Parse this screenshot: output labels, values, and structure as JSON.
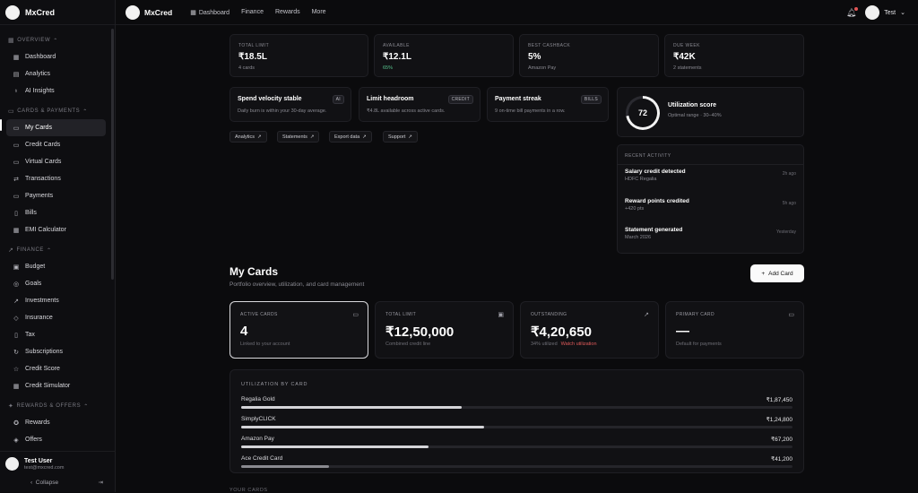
{
  "brand": {
    "name": "MxCred"
  },
  "topbar": {
    "nav": [
      {
        "label": "Dashboard",
        "icon": "grid-icon"
      },
      {
        "label": "Finance"
      },
      {
        "label": "Rewards"
      },
      {
        "label": "More"
      }
    ],
    "user": "Test"
  },
  "sidebar": {
    "sections": [
      {
        "title": "OVERVIEW",
        "items": [
          "Dashboard",
          "Analytics",
          "AI Insights"
        ]
      },
      {
        "title": "CARDS & PAYMENTS",
        "items": [
          "My Cards",
          "Credit Cards",
          "Virtual Cards",
          "Transactions",
          "Payments",
          "Bills",
          "EMI Calculator"
        ]
      },
      {
        "title": "FINANCE",
        "items": [
          "Budget",
          "Goals",
          "Investments",
          "Insurance",
          "Tax",
          "Subscriptions",
          "Credit Score",
          "Credit Simulator"
        ]
      },
      {
        "title": "REWARDS & OFFERS",
        "items": [
          "Rewards",
          "Offers"
        ]
      }
    ],
    "active_item": "My Cards",
    "user": {
      "name": "Test User",
      "email": "test@mxcred.com"
    },
    "collapse_label": "Collapse"
  },
  "stats": [
    {
      "label": "TOTAL LIMIT",
      "value": "₹18.5L",
      "sub": "4 cards"
    },
    {
      "label": "AVAILABLE",
      "value": "₹12.1L",
      "sub": "65%"
    },
    {
      "label": "BEST CASHBACK",
      "value": "5%",
      "sub": "Amazon Pay"
    },
    {
      "label": "DUE WEEK",
      "value": "₹42K",
      "sub": "2 statements"
    }
  ],
  "insights": [
    {
      "title": "Spend velocity stable",
      "badge": "AI",
      "desc": "Daily burn is within your 30-day average."
    },
    {
      "title": "Limit headroom",
      "badge": "CREDIT",
      "desc": "₹4.8L available across active cards."
    },
    {
      "title": "Payment streak",
      "badge": "BILLS",
      "desc": "9 on-time bill payments in a row."
    }
  ],
  "quick_links": [
    "Analytics",
    "Statements",
    "Export data",
    "Support"
  ],
  "utilization_score": {
    "value": 72,
    "title": "Utilization score",
    "sub": "Optimal range · 30–40%"
  },
  "recent_activity": {
    "title": "RECENT ACTIVITY",
    "items": [
      {
        "title": "Salary credit detected",
        "sub": "HDFC Regalia",
        "time": "2h ago"
      },
      {
        "title": "Reward points credited",
        "sub": "+420 pts",
        "time": "5h ago"
      },
      {
        "title": "Statement generated",
        "sub": "March 2026",
        "time": "Yesterday"
      }
    ]
  },
  "page": {
    "title": "My Cards",
    "subtitle": "Portfolio overview, utilization, and card management",
    "add_label": "Add Card"
  },
  "metrics": [
    {
      "label": "ACTIVE CARDS",
      "value": "4",
      "sub": "Linked to your account",
      "icon": "card-icon"
    },
    {
      "label": "TOTAL LIMIT",
      "value": "₹12,50,000",
      "sub": "Combined credit line",
      "icon": "wallet-icon"
    },
    {
      "label": "OUTSTANDING",
      "value": "₹4,20,650",
      "sub": "34% utilized",
      "warn": "Watch utilization",
      "icon": "trend-up-icon"
    },
    {
      "label": "PRIMARY CARD",
      "value": "—",
      "sub": "Default for payments",
      "icon": "card-icon"
    }
  ],
  "utilization_by_card": {
    "title": "UTILIZATION BY CARD",
    "rows": [
      {
        "name": "Regalia Gold",
        "amount": "₹1,87,450",
        "fill": 0.4
      },
      {
        "name": "SimplyCLICK",
        "amount": "₹1,24,800",
        "fill": 0.44
      },
      {
        "name": "Amazon Pay",
        "amount": "₹67,200",
        "fill": 0.34
      },
      {
        "name": "Ace Credit Card",
        "amount": "₹41,200",
        "fill": 0.16
      }
    ]
  },
  "next_section": "YOUR CARDS"
}
